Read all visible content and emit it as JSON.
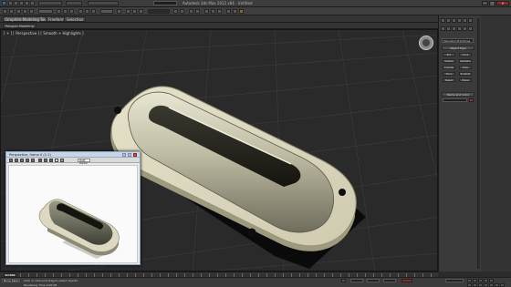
{
  "window": {
    "title": "Autodesk 3ds Max 2012 x64 · Untitled"
  },
  "ribbon": {
    "tabs": [
      {
        "label": "Graphite Modeling Tools"
      },
      {
        "label": "Freeform"
      },
      {
        "label": "Selection"
      }
    ],
    "sub_label": "Polygon Modeling"
  },
  "viewport": {
    "label": "[ + ] [ Perspective ] [ Smooth + Highlights ]"
  },
  "render_window": {
    "title": "Perspective, frame 0 (1:1)",
    "channel": "RGB Alpha"
  },
  "command_panel": {
    "dropdown": "Standard Primitives",
    "rollout_title": "Object Type",
    "buttons": [
      "Box",
      "Cone",
      "Sphere",
      "GeoSphere",
      "Cylinder",
      "Tube",
      "Torus",
      "Pyramid",
      "Teapot",
      "Plane"
    ],
    "name_color_title": "Name and Color",
    "swatch_color": "#b0243a"
  },
  "timeline": {
    "slider": "0 / 100"
  },
  "status": {
    "selection": "None Selected",
    "message": "Click or click-and-drag to select objects",
    "message2": "Rendering Time 0:00:08"
  },
  "colors": {
    "viewport_bg": "#2a2a2a",
    "object_fill": "#c8c7b0",
    "flange_fill": "#ddd9c0"
  }
}
